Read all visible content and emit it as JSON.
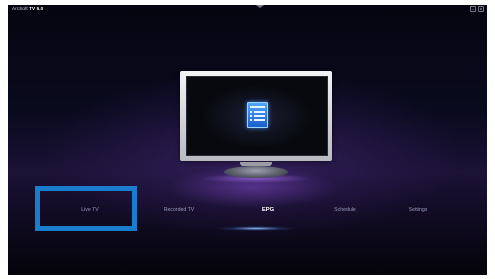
{
  "app": {
    "title_prefix": "ArcSoft ",
    "title_bold": "TV 5.0"
  },
  "window_controls": {
    "minimize_glyph": "−",
    "close_glyph": "×"
  },
  "center": {
    "icon_name": "epg-guide-icon"
  },
  "menu": {
    "items": [
      {
        "label": "Live TV",
        "active": false
      },
      {
        "label": "Recorded TV",
        "active": false
      },
      {
        "label": "EPG",
        "active": true
      },
      {
        "label": "Schedule",
        "active": false
      },
      {
        "label": "Settings",
        "active": false
      }
    ]
  },
  "colors": {
    "focus_outline": "#1a7ccc",
    "active_text": "#ffffff",
    "inactive_text": "#9a9ab8",
    "accent_glow": "#8e5ad6"
  }
}
